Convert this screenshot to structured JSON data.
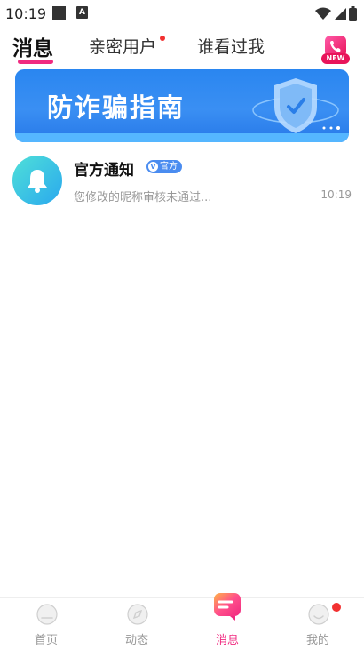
{
  "status_bar": {
    "time": "10:19",
    "a_badge": "A"
  },
  "top_tabs": [
    {
      "label": "消息",
      "active": true
    },
    {
      "label": "亲密用户",
      "active": false,
      "has_dot": true
    },
    {
      "label": "谁看过我",
      "active": false
    }
  ],
  "call_button": {
    "icon": "phone-icon",
    "badge": "NEW"
  },
  "banner": {
    "title": "防诈骗指南"
  },
  "messages": [
    {
      "title": "官方通知",
      "badge_mark": "V",
      "badge": "官方",
      "preview": "您修改的昵称审核未通过...",
      "time": "10:19",
      "icon": "bell-icon"
    }
  ],
  "bottom_nav": [
    {
      "label": "首页",
      "icon": "home-icon",
      "active": false
    },
    {
      "label": "动态",
      "icon": "compass-icon",
      "active": false
    },
    {
      "label": "消息",
      "icon": "message-icon",
      "active": true
    },
    {
      "label": "我的",
      "icon": "profile-icon",
      "active": false,
      "has_dot": true
    }
  ],
  "colors": {
    "accent": "#f02a80",
    "banner": "#2a86f0",
    "badge_blue": "#4a8cf0",
    "dot_red": "#f23131"
  }
}
